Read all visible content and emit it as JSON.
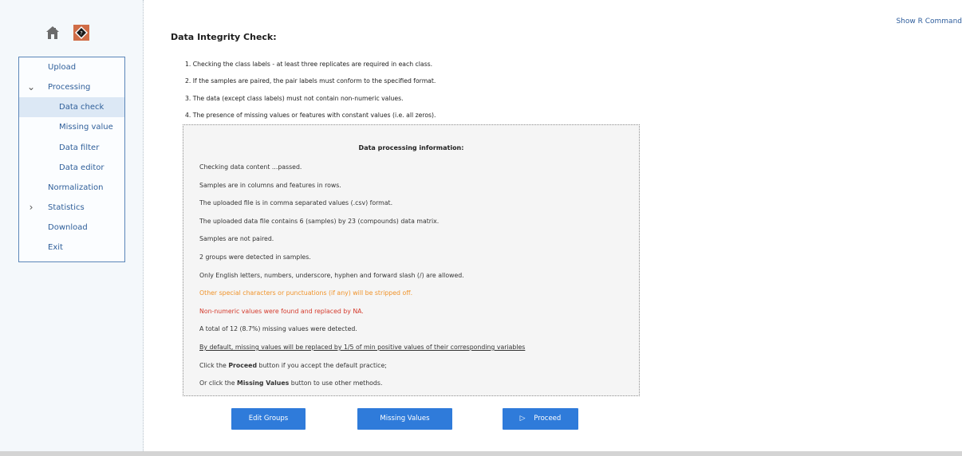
{
  "header": {
    "show_r_command": "Show R Command"
  },
  "sidebar": {
    "icons": [
      "home-icon",
      "help-icon"
    ],
    "items": [
      {
        "label": "Upload",
        "type": "top"
      },
      {
        "label": "Processing",
        "type": "expanded"
      },
      {
        "label": "Data check",
        "type": "sub",
        "active": true
      },
      {
        "label": "Missing value",
        "type": "sub"
      },
      {
        "label": "Data filter",
        "type": "sub"
      },
      {
        "label": "Data editor",
        "type": "sub"
      },
      {
        "label": "Normalization",
        "type": "top"
      },
      {
        "label": "Statistics",
        "type": "collapsed"
      },
      {
        "label": "Download",
        "type": "top"
      },
      {
        "label": "Exit",
        "type": "top"
      }
    ]
  },
  "main": {
    "title": "Data Integrity Check:",
    "checks": [
      "1. Checking the class labels - at least three replicates are required in each class.",
      "2. If the samples are paired, the pair labels must conform to the specified format.",
      "3. The data (except class labels) must not contain non-numeric values.",
      "4. The presence of missing values or features with constant values (i.e. all zeros)."
    ],
    "info": {
      "title": "Data processing information:",
      "lines": [
        "Checking data content ...passed.",
        "Samples are in columns and features in rows.",
        "The uploaded file is in comma separated values (.csv) format.",
        "The uploaded data file contains 6 (samples) by 23 (compounds) data matrix.",
        "Samples are not paired.",
        "2 groups were detected in samples.",
        "Only English letters, numbers, underscore, hyphen and forward slash (/) are allowed.",
        "Other special characters or punctuations (if any) will be stripped off.",
        "Non-numeric values were found and replaced by NA.",
        "A total of 12 (8.7%) missing values were detected.",
        "By default, missing values will be replaced by 1/5 of min positive values of their corresponding variables",
        "Click the ",
        "Proceed",
        " button if you accept the default practice;",
        "Or click the ",
        "Missing Values",
        " button to use other methods."
      ]
    },
    "buttons": {
      "edit_groups": "Edit Groups",
      "missing_values": "Missing Values",
      "proceed": "Proceed"
    }
  },
  "colors": {
    "accent": "#2f7bda",
    "nav_text": "#2f5f9a",
    "warning": "#f0932a",
    "error": "#d43a2c"
  }
}
